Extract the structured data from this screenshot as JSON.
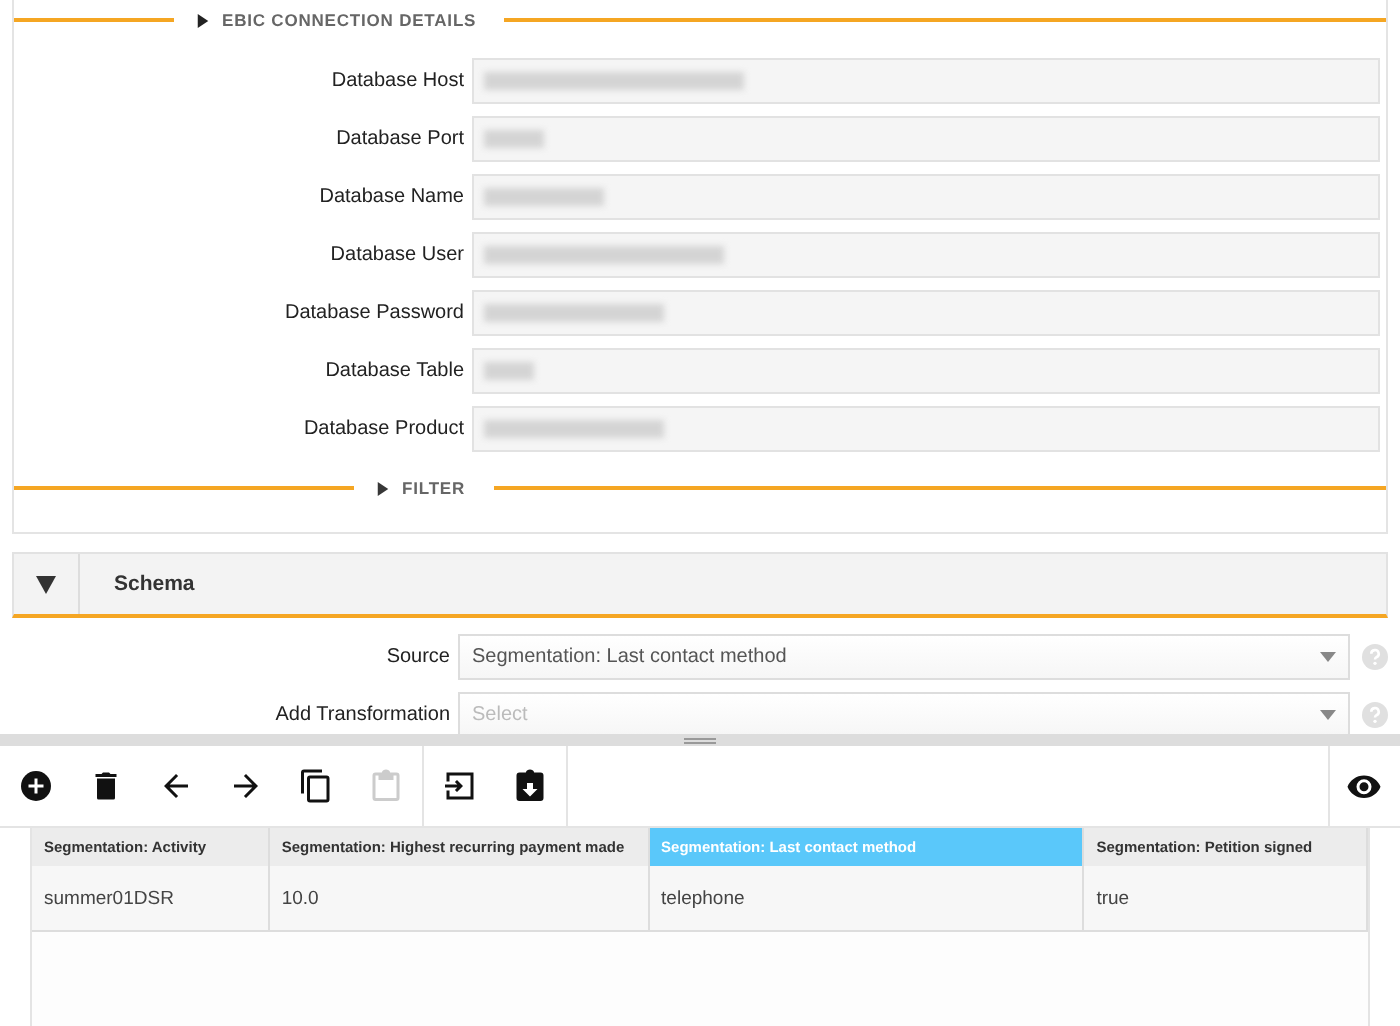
{
  "connection_section": {
    "title": "EBIC CONNECTION DETAILS",
    "expanded": true,
    "fields": [
      {
        "label": "Database Host",
        "redacted": true
      },
      {
        "label": "Database Port",
        "redacted": true
      },
      {
        "label": "Database Name",
        "redacted": true
      },
      {
        "label": "Database User",
        "redacted": true
      },
      {
        "label": "Database Password",
        "redacted": true
      },
      {
        "label": "Database Table",
        "redacted": true
      },
      {
        "label": "Database Product",
        "redacted": true
      }
    ]
  },
  "filter_section": {
    "title": "FILTER",
    "expanded": false
  },
  "schema_panel": {
    "title": "Schema",
    "expanded": true,
    "fields": [
      {
        "label": "Source",
        "value": "Segmentation: Last contact method"
      },
      {
        "label": "Add Transformation",
        "placeholder": "Select"
      }
    ]
  },
  "toolbar": {
    "groups": [
      [
        {
          "kind": "add",
          "disabled": false
        },
        {
          "kind": "delete",
          "disabled": false
        },
        {
          "kind": "back",
          "disabled": false
        },
        {
          "kind": "forward",
          "disabled": false
        },
        {
          "kind": "copy",
          "disabled": false
        },
        {
          "kind": "paste",
          "disabled": true
        }
      ],
      [
        {
          "kind": "import",
          "disabled": false
        },
        {
          "kind": "download",
          "disabled": false
        }
      ]
    ],
    "right": [
      {
        "kind": "eye",
        "disabled": false
      }
    ]
  },
  "table": {
    "columns": [
      {
        "label": "Segmentation: Activity",
        "selected": false
      },
      {
        "label": "Segmentation: Highest recurring payment made",
        "selected": false
      },
      {
        "label": "Segmentation: Last contact method",
        "selected": true
      },
      {
        "label": "Segmentation: Petition signed",
        "selected": false
      }
    ],
    "rows": [
      [
        "summer01DSR",
        "10.0",
        "telephone",
        "true"
      ]
    ]
  }
}
